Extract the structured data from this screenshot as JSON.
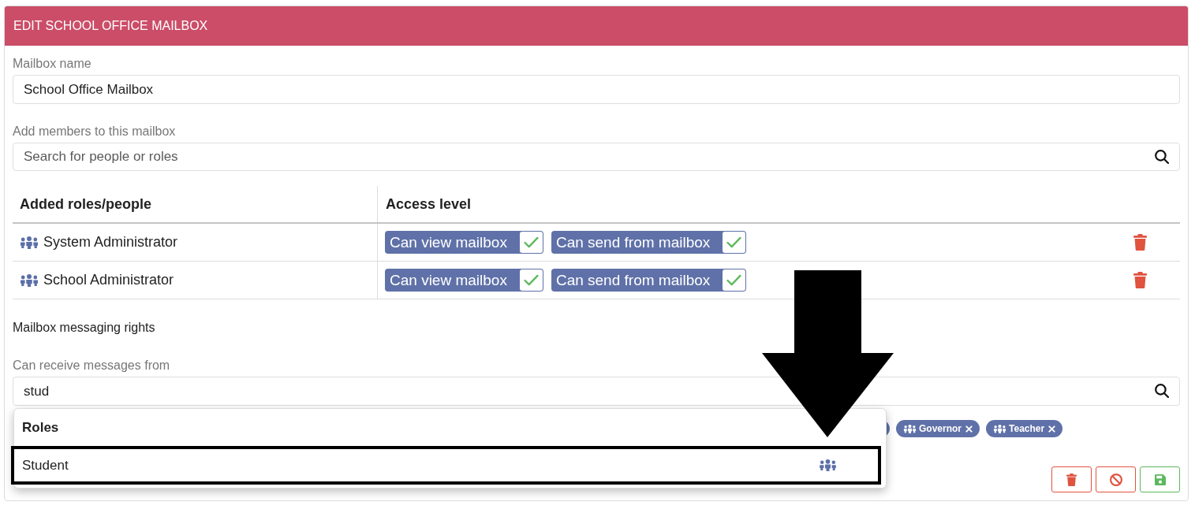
{
  "panel": {
    "title": "EDIT SCHOOL OFFICE MAILBOX"
  },
  "mailbox_name": {
    "label": "Mailbox name",
    "value": "School Office Mailbox"
  },
  "add_members": {
    "label": "Add members to this mailbox",
    "placeholder": "Search for people or roles"
  },
  "members_table": {
    "columns": [
      "Added roles/people",
      "Access level"
    ],
    "rows": [
      {
        "kind": "role",
        "name": "System Administrator",
        "access": [
          {
            "label": "Can view mailbox",
            "checked": true
          },
          {
            "label": "Can send from mailbox",
            "checked": true
          }
        ]
      },
      {
        "kind": "role",
        "name": "School Administrator",
        "access": [
          {
            "label": "Can view mailbox",
            "checked": true
          },
          {
            "label": "Can send from mailbox",
            "checked": true
          }
        ]
      }
    ]
  },
  "messaging_rights": {
    "title": "Mailbox messaging rights",
    "receive_from": {
      "label": "Can receive messages from",
      "value": "stud",
      "dropdown": {
        "heading": "Roles",
        "options": [
          {
            "kind": "role",
            "label": "Student",
            "highlighted": true
          }
        ]
      },
      "tags": [
        {
          "kind": "covered"
        },
        {
          "kind": "role",
          "label": "Governor"
        },
        {
          "kind": "role",
          "label": "Teacher"
        }
      ]
    }
  },
  "actions": [
    {
      "kind": "delete"
    },
    {
      "kind": "cancel"
    },
    {
      "kind": "save"
    }
  ],
  "annotation_arrow": true
}
